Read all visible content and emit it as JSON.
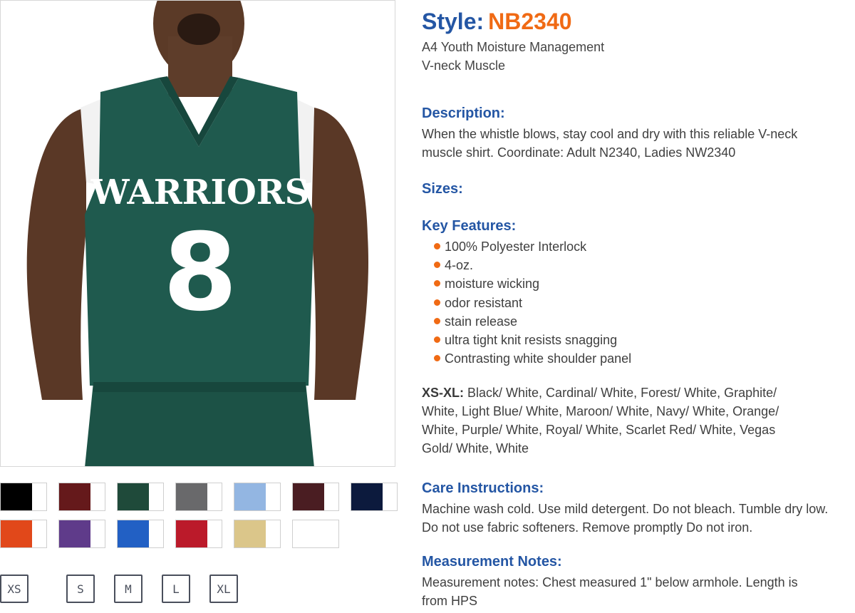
{
  "product": {
    "style_label": "Style:",
    "style_code": "NB2340",
    "name": "A4 Youth Moisture Management V-neck Muscle"
  },
  "jersey_graphic": {
    "team_text": "WARRIORS",
    "number_text": "8"
  },
  "description": {
    "heading": "Description:",
    "text": "When the whistle blows, stay cool and dry with this reliable V-neck muscle shirt. Coordinate: Adult N2340, Ladies NW2340"
  },
  "sizes_section": {
    "heading": "Sizes:"
  },
  "features": {
    "heading": "Key Features:",
    "items": [
      "100% Polyester Interlock",
      "4-oz.",
      "moisture wicking",
      "odor resistant",
      "stain release",
      "ultra tight knit resists snagging",
      "Contrasting white shoulder panel"
    ]
  },
  "colors": {
    "range_label": "XS-XL:",
    "list_text": "Black/ White, Cardinal/ White, Forest/ White, Graphite/ White, Light Blue/ White, Maroon/ White, Navy/ White, Orange/ White, Purple/ White, Royal/ White, Scarlet Red/ White, Vegas Gold/ White, White"
  },
  "care": {
    "heading": "Care Instructions:",
    "text": "Machine wash cold. Use mild detergent. Do not bleach. Tumble dry low. Do not use fabric softeners. Remove promptly Do not iron."
  },
  "measurement": {
    "heading": "Measurement Notes:",
    "text": "Measurement notes: Chest measured 1\" below armhole. Length is from HPS"
  },
  "swatches": [
    {
      "name": "Black/ White",
      "color": "#000000"
    },
    {
      "name": "Cardinal/ White",
      "color": "#65191b"
    },
    {
      "name": "Forest/ White",
      "color": "#1f4a3a"
    },
    {
      "name": "Graphite/ White",
      "color": "#69696b"
    },
    {
      "name": "Light Blue/ White",
      "color": "#93b6e2"
    },
    {
      "name": "Maroon/ White",
      "color": "#4a1d22"
    },
    {
      "name": "Navy/ White",
      "color": "#0c1a3d"
    },
    {
      "name": "Orange/ White",
      "color": "#e1481a"
    },
    {
      "name": "Purple/ White",
      "color": "#5f3b8a"
    },
    {
      "name": "Royal/ White",
      "color": "#2260c4"
    },
    {
      "name": "Scarlet Red/ White",
      "color": "#bb1a2a"
    },
    {
      "name": "Vegas Gold/ White",
      "color": "#dbc68a"
    },
    {
      "name": "White",
      "color": "#ffffff"
    }
  ],
  "size_buttons": [
    "XS",
    "S",
    "M",
    "L",
    "XL"
  ],
  "theme": {
    "heading_blue": "#2456a4",
    "accent_orange": "#f06a14",
    "jersey_green": "#1f5a4e"
  }
}
